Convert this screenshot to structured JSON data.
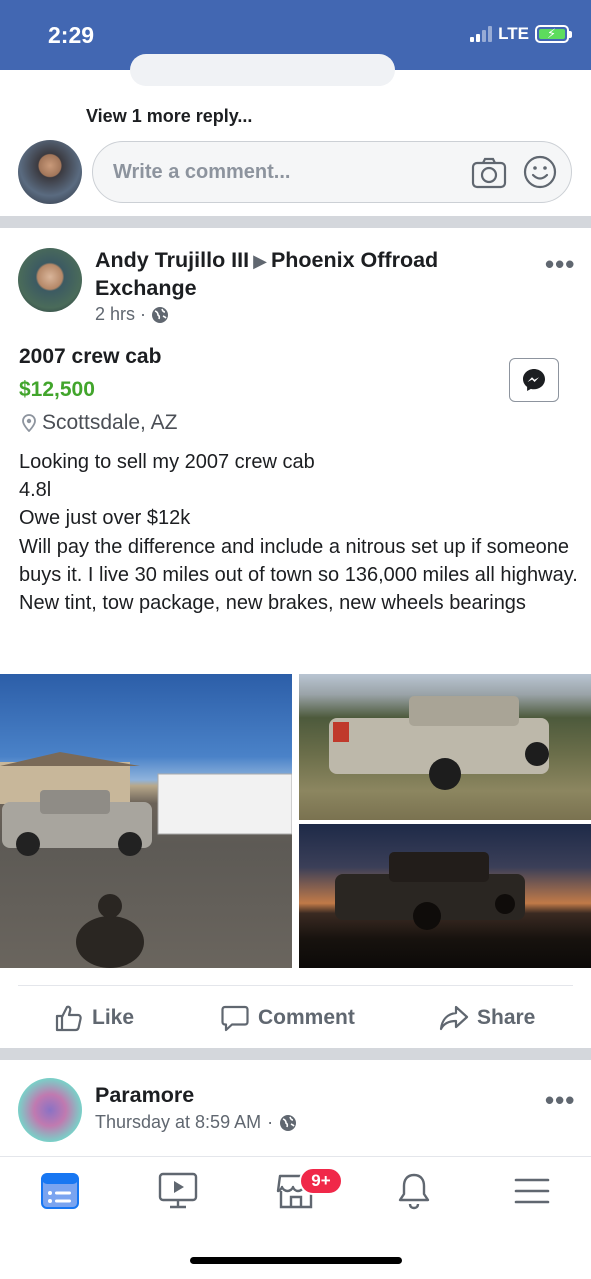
{
  "status_bar": {
    "time": "2:29",
    "network": "LTE"
  },
  "comments": {
    "view_more": "View 1 more reply...",
    "input_placeholder": "Write a comment..."
  },
  "post": {
    "author": "Andy Trujillo III",
    "group": "Phoenix Offroad Exchange",
    "time": "2 hrs",
    "more": "•••",
    "listing": {
      "title": "2007 crew cab",
      "price": "$12,500",
      "location": "Scottsdale, AZ"
    },
    "description": [
      "Looking to sell my 2007 crew cab",
      "4.8l",
      "Owe just over $12k",
      "Will pay the difference and include a nitrous set up if someone buys it. I live 30 miles out of town so 136,000 miles all highway. New tint, tow package, new brakes, new wheels bearings"
    ],
    "actions": {
      "like": "Like",
      "comment": "Comment",
      "share": "Share"
    }
  },
  "next_post": {
    "author": "Paramore",
    "time": "Thursday at 8:59 AM",
    "more": "•••"
  },
  "tabbar": {
    "icons": [
      "news-feed-icon",
      "watch-icon",
      "marketplace-icon",
      "notifications-icon",
      "menu-icon"
    ],
    "marketplace_badge": "9+"
  },
  "colors": {
    "brand": "#4267b2",
    "price": "#42a52c",
    "active_tab": "#1877f2",
    "badge": "#f02849"
  }
}
